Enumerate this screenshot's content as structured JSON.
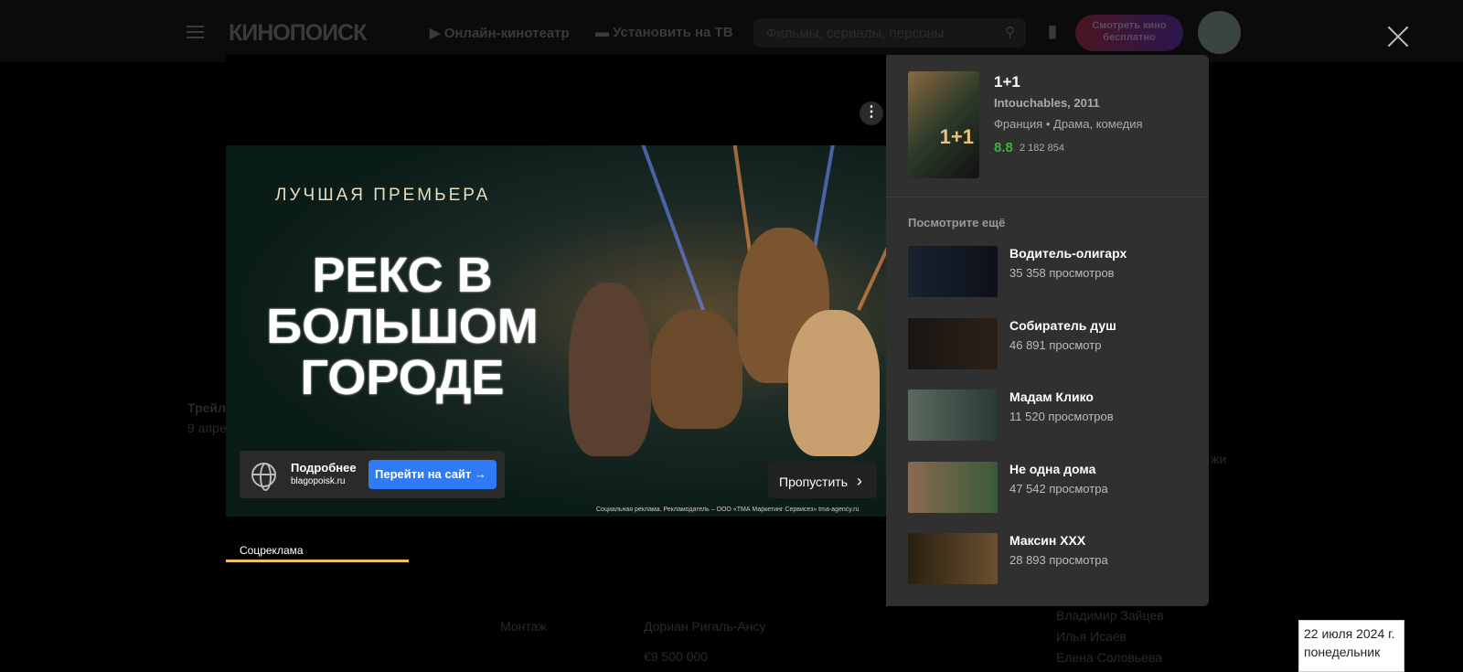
{
  "header": {
    "logo": "КИНОПОИСК",
    "nav": [
      "Онлайн-кинотеатр",
      "Установить на ТВ"
    ],
    "search_placeholder": "Фильмы, сериалы, персоны",
    "cta": "Смотреть кино бесплатно"
  },
  "background": {
    "texts": [
      "Трейл",
      "9 апре",
      "Монтаж",
      "Дориан Ригаль-Ансу",
      "€9 500 000",
      "жи",
      "Владимир Зайцев",
      "Илья Исаев",
      "Елена Соловьева"
    ]
  },
  "ad": {
    "premiere": "ЛУЧШАЯ ПРЕМЬЕРА",
    "title": "РЕКС В БОЛЬШОМ ГОРОДЕ",
    "more": "Подробнее",
    "domain": "blagopoisk.ru",
    "go": "Перейти на сайт →",
    "skip": "Пропустить",
    "legal": "Социальная реклама. Рекламодатель – ООО «ТМА Маркетинг Сервисез» tma-agency.ru",
    "tab": "Соцреклама",
    "progress": 0.3
  },
  "movie": {
    "title": "1+1",
    "original": "Intouchables, 2011",
    "meta": "Франция • Драма, комедия",
    "rating": "8.8",
    "votes": "2 182 854",
    "rating_color": "#3bb33b"
  },
  "more": {
    "heading": "Посмотрите ещё",
    "items": [
      {
        "title": "Водитель-олигарх",
        "views": "35 358 просмотров"
      },
      {
        "title": "Собиратель душ",
        "views": "46 891 просмотр"
      },
      {
        "title": "Мадам Клико",
        "views": "11 520 просмотров"
      },
      {
        "title": "Не одна дома",
        "views": "47 542 просмотра"
      },
      {
        "title": "Максин XXX",
        "views": "28 893 просмотра"
      }
    ]
  },
  "clock": {
    "date": "22 июля 2024 г.",
    "day": "понедельник"
  }
}
